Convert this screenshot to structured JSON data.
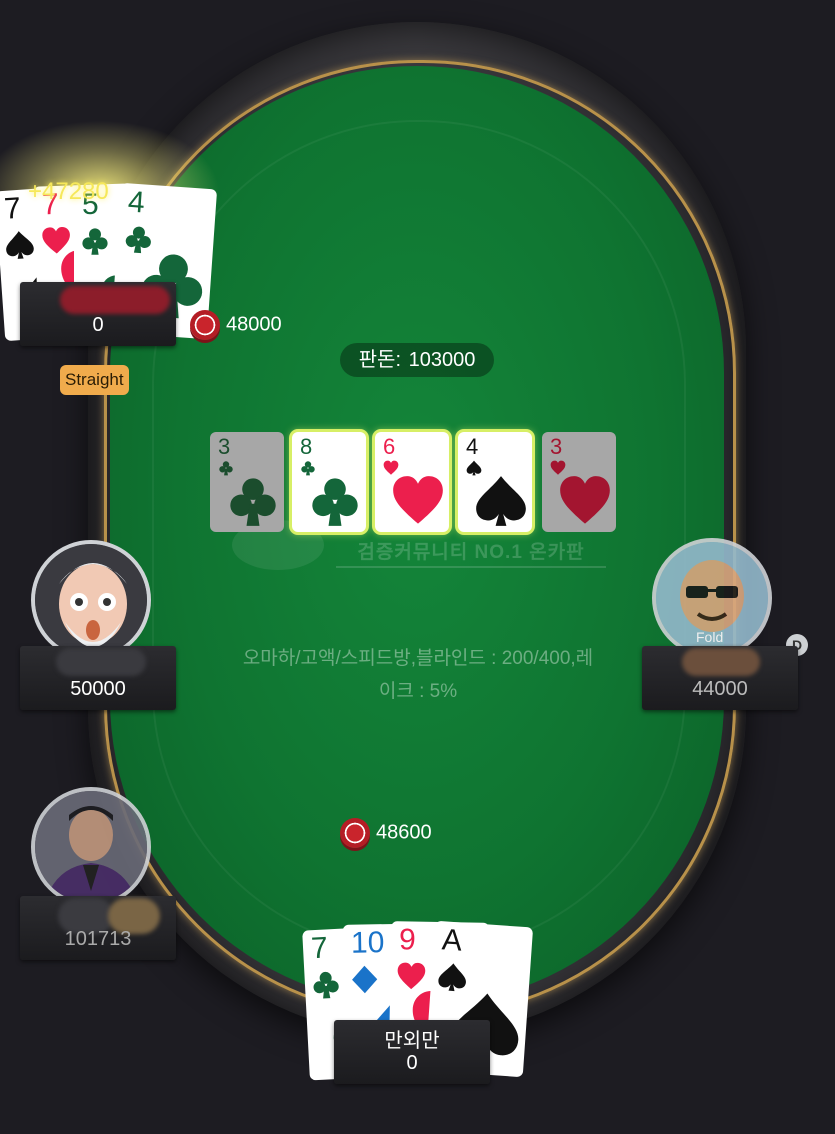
{
  "pot": {
    "label": "판돈:",
    "amount": "103000"
  },
  "watermark": "검증커뮤니티 NO.1 온카판",
  "table_info": [
    "오마하/고액/스피드방,블라인드 : 200/400,레",
    "이크 : 5%"
  ],
  "board": [
    {
      "rank": "3",
      "suit": "club",
      "highlighted": false
    },
    {
      "rank": "8",
      "suit": "club",
      "highlighted": true
    },
    {
      "rank": "6",
      "suit": "heart",
      "highlighted": true
    },
    {
      "rank": "4",
      "suit": "spade",
      "highlighted": true
    },
    {
      "rank": "3",
      "suit": "heart",
      "highlighted": false
    }
  ],
  "seats": {
    "top_left": {
      "win_amount": "+47280",
      "stack": "0",
      "bet": "48000",
      "hand_rank": "Straight",
      "cards": [
        {
          "rank": "7",
          "suit": "spade"
        },
        {
          "rank": "7",
          "suit": "heart"
        },
        {
          "rank": "5",
          "suit": "club"
        },
        {
          "rank": "4",
          "suit": "club"
        }
      ]
    },
    "mid_left": {
      "stack": "50000"
    },
    "mid_right": {
      "stack": "44000",
      "status": "Fold",
      "dealer": "D"
    },
    "bottom_left": {
      "stack": "101713"
    },
    "hero": {
      "name": "만외만",
      "stack": "0",
      "bet": "48600",
      "cards": [
        {
          "rank": "7",
          "suit": "club"
        },
        {
          "rank": "10",
          "suit": "diamond"
        },
        {
          "rank": "9",
          "suit": "heart"
        },
        {
          "rank": "A",
          "suit": "spade"
        }
      ]
    }
  },
  "colors": {
    "felt": "#0f7431",
    "rail_gold": "#b8914a",
    "highlight": "#d7ef66",
    "badge": "#f0ab4c"
  }
}
